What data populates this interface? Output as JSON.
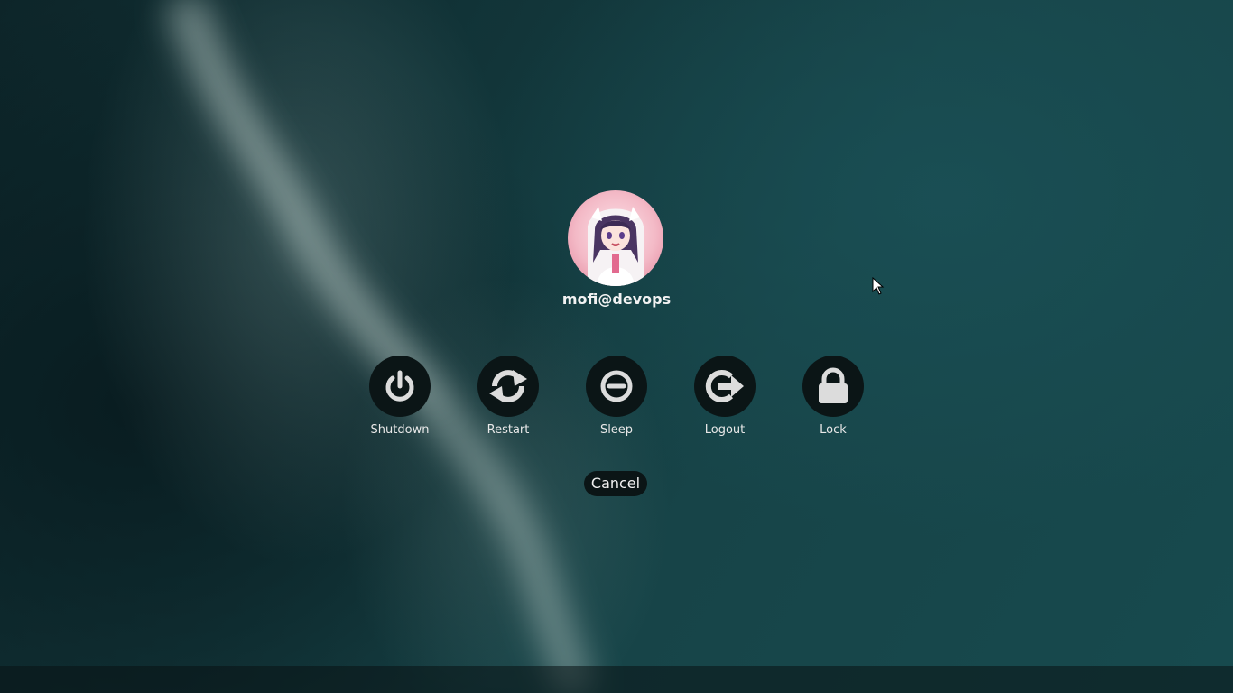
{
  "user": {
    "name": "mofi@devops"
  },
  "actions": [
    {
      "label": "Shutdown",
      "icon": "power-icon"
    },
    {
      "label": "Restart",
      "icon": "restart-icon"
    },
    {
      "label": "Sleep",
      "icon": "sleep-icon"
    },
    {
      "label": "Logout",
      "icon": "logout-icon"
    },
    {
      "label": "Lock",
      "icon": "lock-icon"
    }
  ],
  "cancel_label": "Cancel",
  "colors": {
    "button_bg": "#0b1516",
    "icon": "#dcdcdc",
    "text": "#f2f2f2"
  }
}
